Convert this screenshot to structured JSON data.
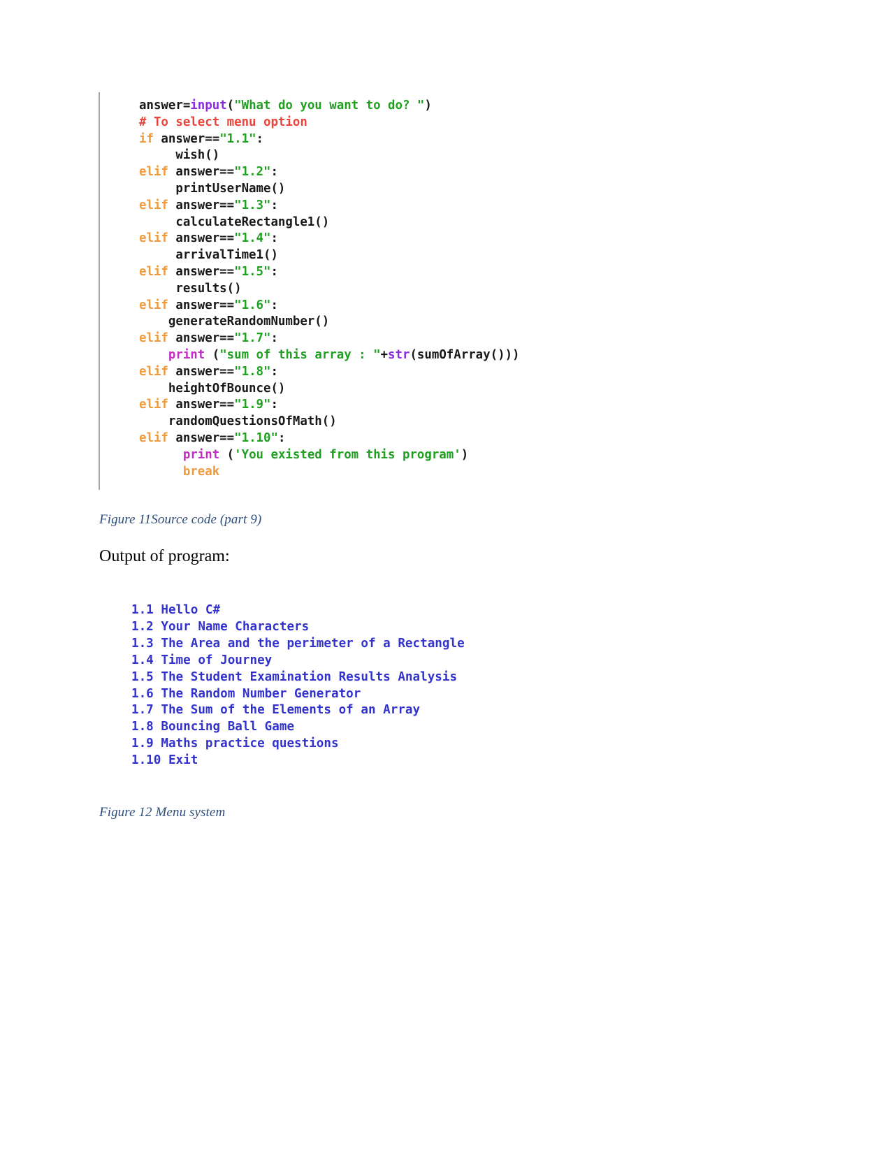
{
  "document": {
    "figure_11": {
      "caption": "Figure 11Source code (part 9)",
      "code_lines": [
        [
          {
            "text": "answer=",
            "cls": "t-plain"
          },
          {
            "text": "input",
            "cls": "t-builtin"
          },
          {
            "text": "(",
            "cls": "t-plain"
          },
          {
            "text": "\"What do you want to do? \"",
            "cls": "t-str"
          },
          {
            "text": ")",
            "cls": "t-plain"
          }
        ],
        [
          {
            "text": "# To select menu option",
            "cls": "t-comment"
          }
        ],
        [
          {
            "text": "if",
            "cls": "t-kw"
          },
          {
            "text": " answer==",
            "cls": "t-plain"
          },
          {
            "text": "\"1.1\"",
            "cls": "t-str"
          },
          {
            "text": ":",
            "cls": "t-plain"
          }
        ],
        [
          {
            "text": "     wish()",
            "cls": "t-plain"
          }
        ],
        [
          {
            "text": "elif",
            "cls": "t-kw"
          },
          {
            "text": " answer==",
            "cls": "t-plain"
          },
          {
            "text": "\"1.2\"",
            "cls": "t-str"
          },
          {
            "text": ":",
            "cls": "t-plain"
          }
        ],
        [
          {
            "text": "     printUserName()",
            "cls": "t-plain"
          }
        ],
        [
          {
            "text": "elif",
            "cls": "t-kw"
          },
          {
            "text": " answer==",
            "cls": "t-plain"
          },
          {
            "text": "\"1.3\"",
            "cls": "t-str"
          },
          {
            "text": ":",
            "cls": "t-plain"
          }
        ],
        [
          {
            "text": "     calculateRectangle1()",
            "cls": "t-plain"
          }
        ],
        [
          {
            "text": "elif",
            "cls": "t-kw"
          },
          {
            "text": " answer==",
            "cls": "t-plain"
          },
          {
            "text": "\"1.4\"",
            "cls": "t-str"
          },
          {
            "text": ":",
            "cls": "t-plain"
          }
        ],
        [
          {
            "text": "     arrivalTime1()",
            "cls": "t-plain"
          }
        ],
        [
          {
            "text": "elif",
            "cls": "t-kw"
          },
          {
            "text": " answer==",
            "cls": "t-plain"
          },
          {
            "text": "\"1.5\"",
            "cls": "t-str"
          },
          {
            "text": ":",
            "cls": "t-plain"
          }
        ],
        [
          {
            "text": "     results()",
            "cls": "t-plain"
          }
        ],
        [
          {
            "text": "elif",
            "cls": "t-kw"
          },
          {
            "text": " answer==",
            "cls": "t-plain"
          },
          {
            "text": "\"1.6\"",
            "cls": "t-str"
          },
          {
            "text": ":",
            "cls": "t-plain"
          }
        ],
        [
          {
            "text": "    generateRandomNumber()",
            "cls": "t-plain"
          }
        ],
        [
          {
            "text": "elif",
            "cls": "t-kw"
          },
          {
            "text": " answer==",
            "cls": "t-plain"
          },
          {
            "text": "\"1.7\"",
            "cls": "t-str"
          },
          {
            "text": ":",
            "cls": "t-plain"
          }
        ],
        [
          {
            "text": "    ",
            "cls": "t-plain"
          },
          {
            "text": "print",
            "cls": "t-print"
          },
          {
            "text": " (",
            "cls": "t-plain"
          },
          {
            "text": "\"sum of this array : \"",
            "cls": "t-str"
          },
          {
            "text": "+",
            "cls": "t-plain"
          },
          {
            "text": "str",
            "cls": "t-builtin"
          },
          {
            "text": "(sumOfArray()))",
            "cls": "t-plain"
          }
        ],
        [
          {
            "text": "elif",
            "cls": "t-kw"
          },
          {
            "text": " answer==",
            "cls": "t-plain"
          },
          {
            "text": "\"1.8\"",
            "cls": "t-str"
          },
          {
            "text": ":",
            "cls": "t-plain"
          }
        ],
        [
          {
            "text": "    heightOfBounce()",
            "cls": "t-plain"
          }
        ],
        [
          {
            "text": "elif",
            "cls": "t-kw"
          },
          {
            "text": " answer==",
            "cls": "t-plain"
          },
          {
            "text": "\"1.9\"",
            "cls": "t-str"
          },
          {
            "text": ":",
            "cls": "t-plain"
          }
        ],
        [
          {
            "text": "    randomQuestionsOfMath()",
            "cls": "t-plain"
          }
        ],
        [
          {
            "text": "elif",
            "cls": "t-kw"
          },
          {
            "text": " answer==",
            "cls": "t-plain"
          },
          {
            "text": "\"1.10\"",
            "cls": "t-str"
          },
          {
            "text": ":",
            "cls": "t-plain"
          }
        ],
        [
          {
            "text": "      ",
            "cls": "t-plain"
          },
          {
            "text": "print",
            "cls": "t-print"
          },
          {
            "text": " (",
            "cls": "t-plain"
          },
          {
            "text": "'You existed from this program'",
            "cls": "t-str"
          },
          {
            "text": ")",
            "cls": "t-plain"
          }
        ],
        [
          {
            "text": "      ",
            "cls": "t-plain"
          },
          {
            "text": "break",
            "cls": "t-kw"
          }
        ]
      ]
    },
    "output_heading": "Output of program:",
    "figure_12": {
      "caption": "Figure 12 Menu system",
      "menu_lines": [
        "1.1 Hello C#",
        "1.2 Your Name Characters",
        "1.3 The Area and the perimeter of a Rectangle",
        "1.4 Time of Journey",
        "1.5 The Student Examination Results Analysis",
        "1.6 The Random Number Generator",
        "1.7 The Sum of the Elements of an Array",
        "1.8 Bouncing Ball Game",
        "1.9 Maths practice questions",
        "1.10 Exit"
      ]
    }
  },
  "colors": {
    "keyword": "#ef9a3c",
    "builtin": "#8a2be2",
    "print": "#c22ec2",
    "string": "#20a020",
    "comment": "#e8453c",
    "menu_text": "#3333cc",
    "caption_text": "#2d4d7a",
    "code_rule": "#a6a6a6"
  }
}
